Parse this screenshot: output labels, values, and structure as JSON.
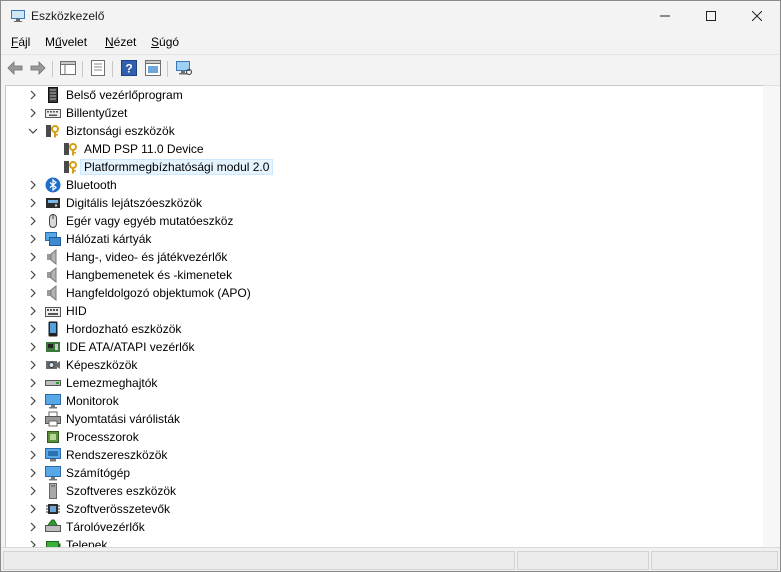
{
  "window": {
    "title": "Eszközkezelő",
    "controls": {
      "minimize": "minimize-icon",
      "maximize": "maximize-icon",
      "close": "close-icon"
    }
  },
  "menu": {
    "file": {
      "accel": "F",
      "rest": "ájl"
    },
    "action": {
      "pre": "M",
      "accel": "ű",
      "rest": "velet"
    },
    "view": {
      "accel": "N",
      "rest": "ézet"
    },
    "help": {
      "accel": "S",
      "rest": "úgó"
    }
  },
  "toolbar": {
    "icons": [
      "back-arrow-icon",
      "forward-arrow-icon",
      "properties-icon",
      "show-hide-console-tree-icon",
      "help-icon",
      "update-driver-icon",
      "scan-hardware-icon"
    ]
  },
  "tree": {
    "nodes": [
      {
        "label": "Belső vezérlőprogram",
        "icon": "firmware-icon",
        "state": "collapsed"
      },
      {
        "label": "Billentyűzet",
        "icon": "keyboard-icon",
        "state": "collapsed"
      },
      {
        "label": "Biztonsági eszközök",
        "icon": "security-key-icon",
        "state": "expanded"
      },
      {
        "label": "AMD PSP 11.0 Device",
        "icon": "security-key-icon",
        "state": "leaf"
      },
      {
        "label": "Platformmegbízhatósági modul 2.0",
        "icon": "security-key-icon",
        "state": "leaf",
        "selected": true
      },
      {
        "label": "Bluetooth",
        "icon": "bluetooth-icon",
        "state": "collapsed"
      },
      {
        "label": "Digitális lejátszóeszközök",
        "icon": "media-player-icon",
        "state": "collapsed"
      },
      {
        "label": "Egér vagy egyéb mutatóeszköz",
        "icon": "mouse-icon",
        "state": "collapsed"
      },
      {
        "label": "Hálózati kártyák",
        "icon": "network-adapter-icon",
        "state": "collapsed"
      },
      {
        "label": "Hang-, video- és játékvezérlők",
        "icon": "speaker-icon",
        "state": "collapsed"
      },
      {
        "label": "Hangbemenetek és -kimenetek",
        "icon": "speaker-icon",
        "state": "collapsed"
      },
      {
        "label": "Hangfeldolgozó objektumok (APO)",
        "icon": "speaker-icon",
        "state": "collapsed"
      },
      {
        "label": "HID",
        "icon": "hid-icon",
        "state": "collapsed"
      },
      {
        "label": "Hordozható eszközök",
        "icon": "portable-device-icon",
        "state": "collapsed"
      },
      {
        "label": "IDE ATA/ATAPI vezérlők",
        "icon": "ide-controller-icon",
        "state": "collapsed"
      },
      {
        "label": "Képeszközök",
        "icon": "camera-icon",
        "state": "collapsed"
      },
      {
        "label": "Lemezmeghajtók",
        "icon": "disk-drive-icon",
        "state": "collapsed"
      },
      {
        "label": "Monitorok",
        "icon": "monitor-icon",
        "state": "collapsed"
      },
      {
        "label": "Nyomtatási várólisták",
        "icon": "printer-icon",
        "state": "collapsed"
      },
      {
        "label": "Processzorok",
        "icon": "processor-icon",
        "state": "collapsed"
      },
      {
        "label": "Rendszereszközök",
        "icon": "system-device-icon",
        "state": "collapsed"
      },
      {
        "label": "Számítógép",
        "icon": "computer-icon",
        "state": "collapsed"
      },
      {
        "label": "Szoftveres eszközök",
        "icon": "software-device-icon",
        "state": "collapsed"
      },
      {
        "label": "Szoftverösszetevők",
        "icon": "software-component-icon",
        "state": "collapsed"
      },
      {
        "label": "Tárolóvezérlők",
        "icon": "storage-controller-icon",
        "state": "collapsed"
      },
      {
        "label": "Telepek",
        "icon": "battery-icon",
        "state": "collapsed"
      }
    ]
  },
  "colors": {
    "selection": "#e5f3ff",
    "selection_border": "#cce8ff",
    "accent": "#0067c0",
    "key_gold": "#d4a017"
  }
}
